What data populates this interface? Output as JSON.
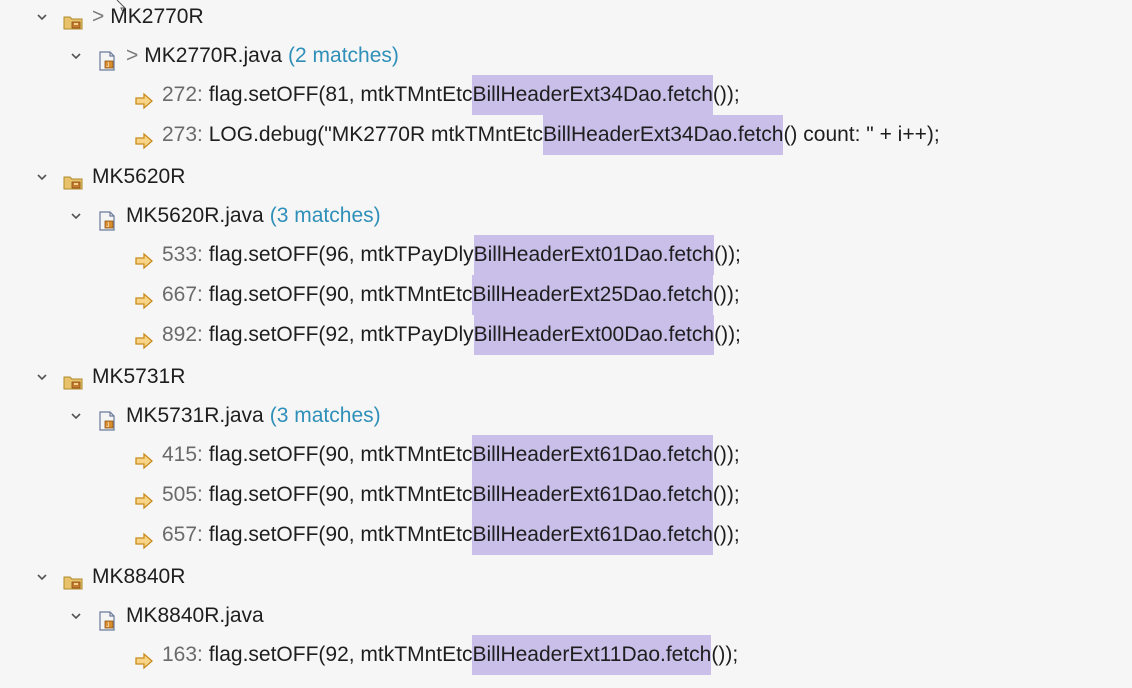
{
  "tree": [
    {
      "package": "MK2770R",
      "show_gt": true,
      "file": "MK2770R.java",
      "file_show_gt": true,
      "matches_label": "(2 matches)",
      "lines": [
        {
          "num": "272:",
          "pre": "flag.setOFF(81, mtkTMntEtc",
          "hl": "BillHeaderExt34Dao.fetch",
          "post": "());"
        },
        {
          "num": "273:",
          "pre": "LOG.debug(\"MK2770R mtkTMntEtc",
          "hl": "BillHeaderExt34Dao.fetch",
          "post": "() count: \" + i++);"
        }
      ]
    },
    {
      "package": "MK5620R",
      "show_gt": false,
      "file": "MK5620R.java",
      "file_show_gt": false,
      "matches_label": "(3 matches)",
      "lines": [
        {
          "num": "533:",
          "pre": "flag.setOFF(96, mtkTPayDly",
          "hl": "BillHeaderExt01Dao.fetch",
          "post": "());"
        },
        {
          "num": "667:",
          "pre": "flag.setOFF(90, mtkTMntEtc",
          "hl": "BillHeaderExt25Dao.fetch",
          "post": "());"
        },
        {
          "num": "892:",
          "pre": "flag.setOFF(92, mtkTPayDly",
          "hl": "BillHeaderExt00Dao.fetch",
          "post": "());"
        }
      ]
    },
    {
      "package": "MK5731R",
      "show_gt": false,
      "file": "MK5731R.java",
      "file_show_gt": false,
      "matches_label": "(3 matches)",
      "lines": [
        {
          "num": "415:",
          "pre": "flag.setOFF(90, mtkTMntEtc",
          "hl": "BillHeaderExt61Dao.fetch",
          "post": "());"
        },
        {
          "num": "505:",
          "pre": "flag.setOFF(90, mtkTMntEtc",
          "hl": "BillHeaderExt61Dao.fetch",
          "post": "());"
        },
        {
          "num": "657:",
          "pre": "flag.setOFF(90, mtkTMntEtc",
          "hl": "BillHeaderExt61Dao.fetch",
          "post": "());"
        }
      ]
    },
    {
      "package": "MK8840R",
      "show_gt": false,
      "file": "MK8840R.java",
      "file_show_gt": false,
      "matches_label": "",
      "lines": [
        {
          "num": "163:",
          "pre": "flag.setOFF(92, mtkTMntEtc",
          "hl": "BillHeaderExt11Dao.fetch",
          "post": "());"
        }
      ]
    }
  ],
  "symbols": {
    "gt": ">"
  },
  "colors": {
    "highlight": "#c9bfe8",
    "matches": "#2e8fb8",
    "background": "#f6f6f6"
  }
}
